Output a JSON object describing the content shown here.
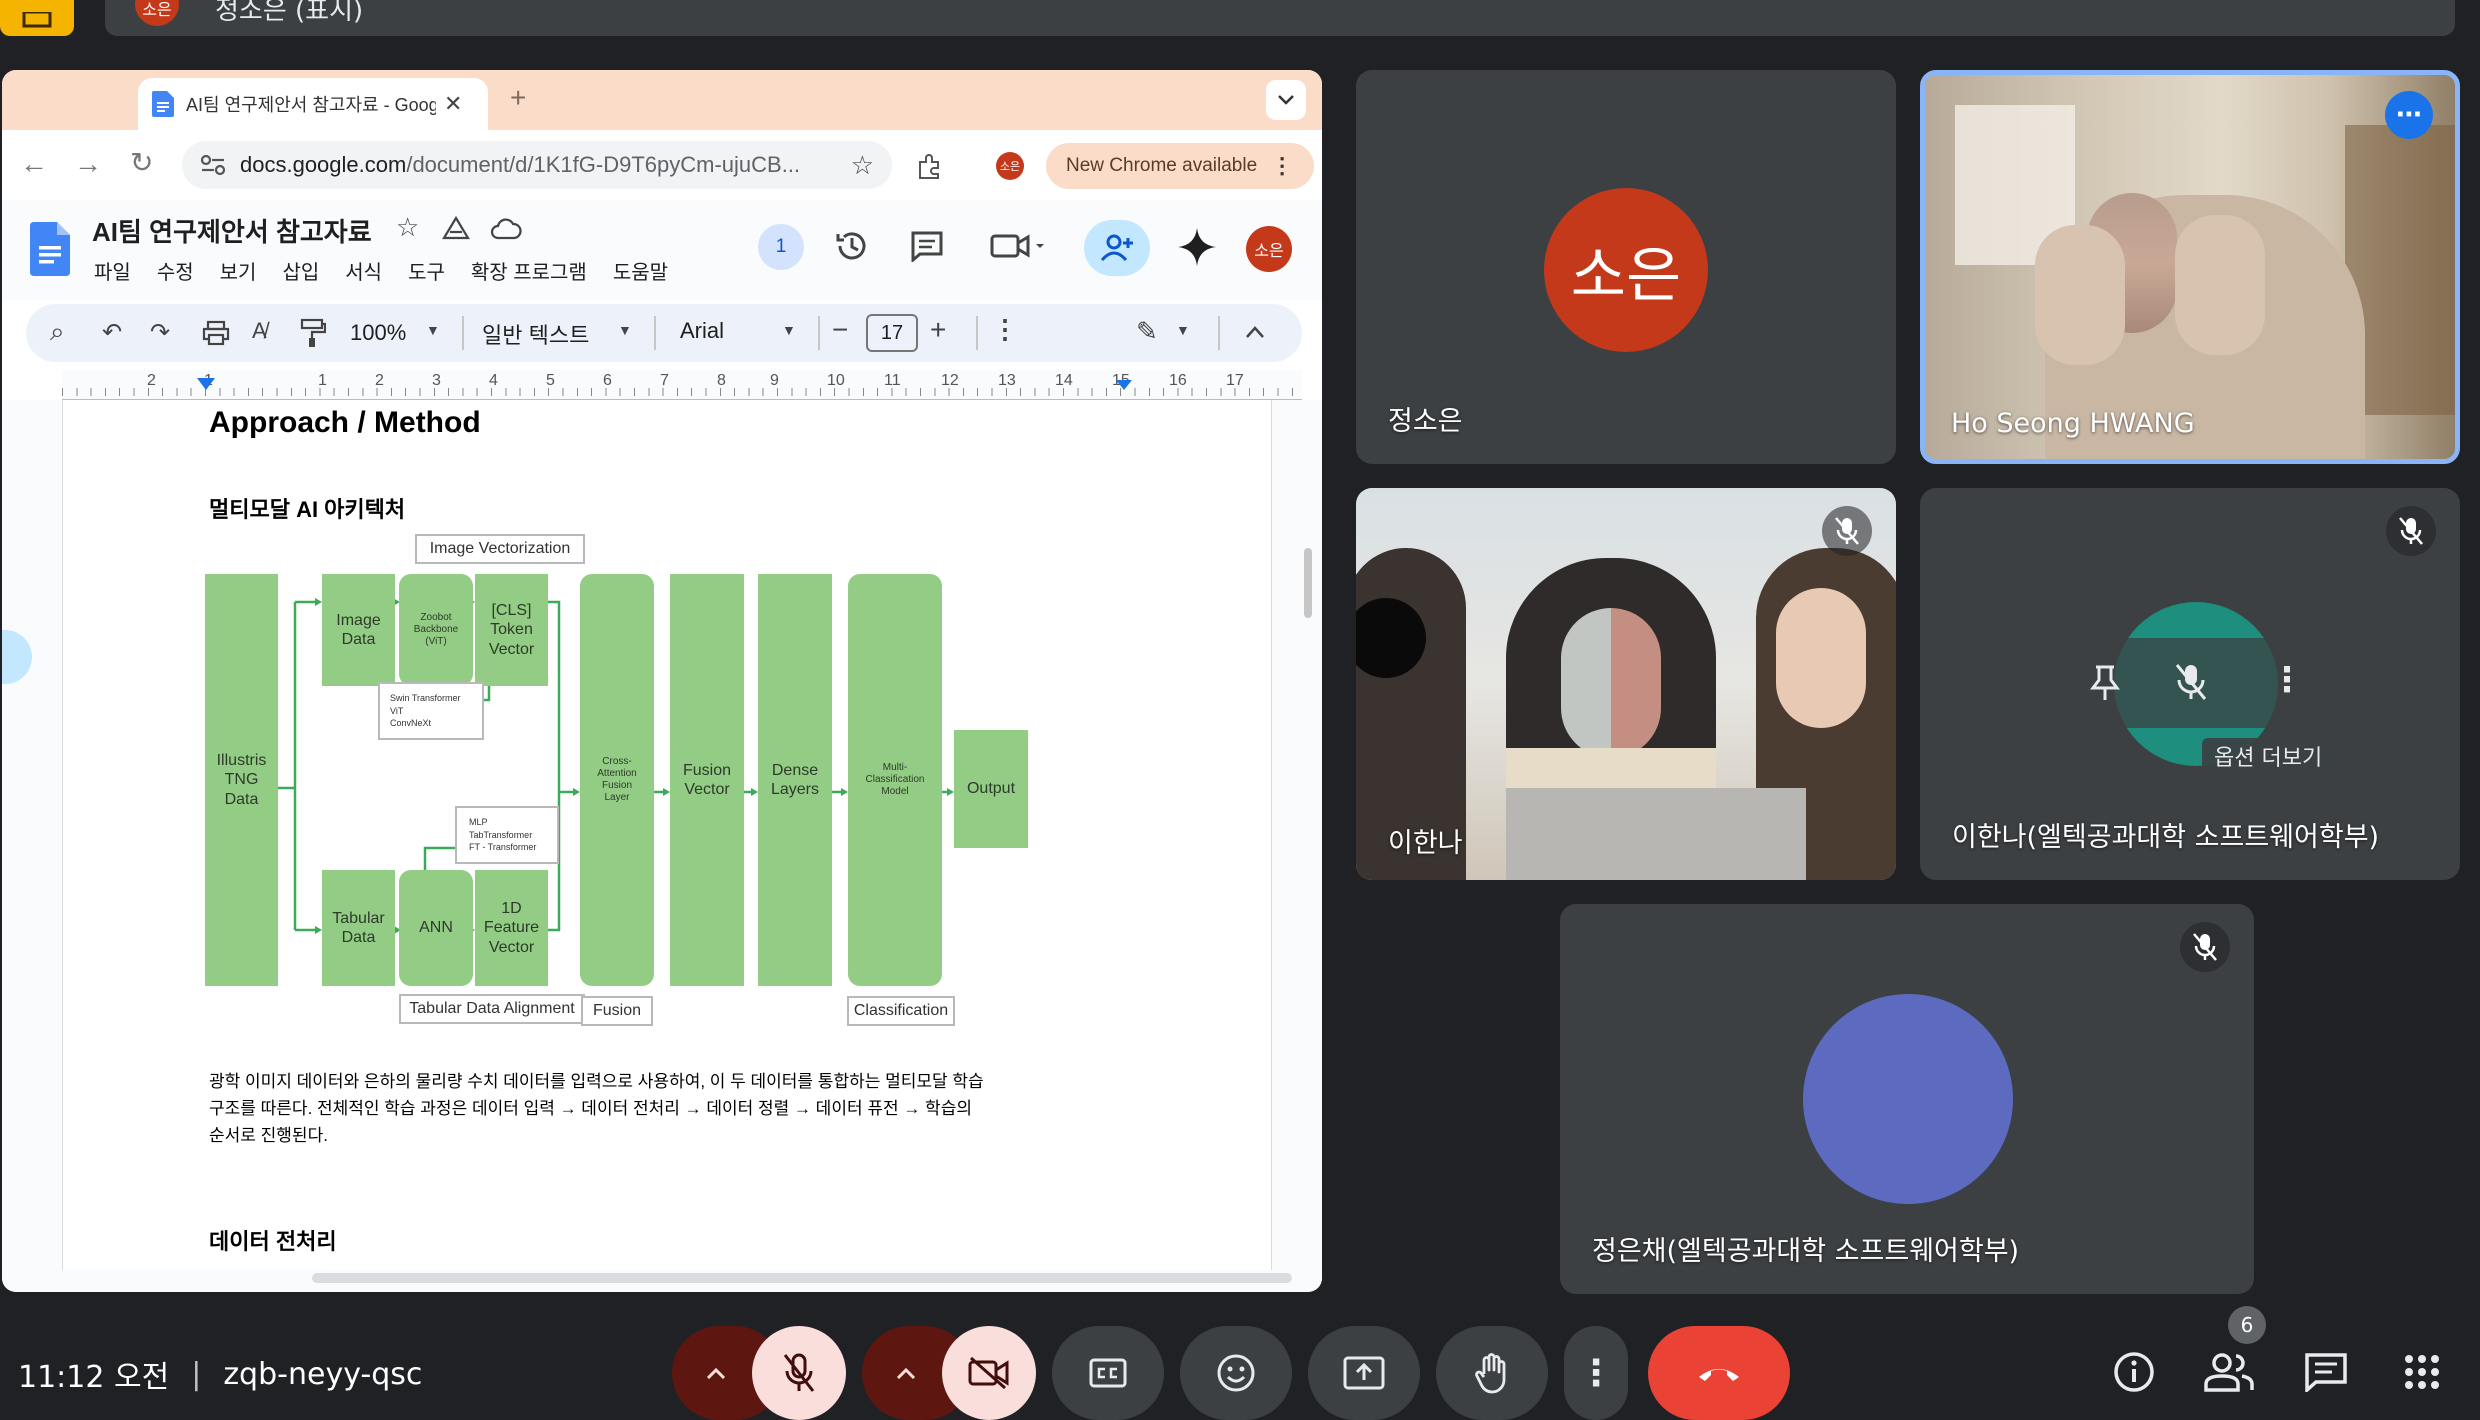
{
  "meet_top": {
    "avatar": "소은",
    "presenter": "정소은 (표시)"
  },
  "browser": {
    "tab_title": "AI팀 연구제안서 참고자료 - Goog",
    "new_tab": "+",
    "url_domain": "docs.google.com",
    "url_path": "/document/d/1K1fG-D9T6pyCm-ujuCB...",
    "profile": "소은",
    "update_btn": "New Chrome available"
  },
  "docs": {
    "title": "AI팀 연구제안서 참고자료",
    "menus": [
      "파일",
      "수정",
      "보기",
      "삽입",
      "서식",
      "도구",
      "확장 프로그램",
      "도움말"
    ],
    "badge_count": "1",
    "avatar": "소은",
    "zoom": "100%",
    "style": "일반 텍스트",
    "font": "Arial",
    "font_size": "17",
    "minus": "−",
    "plus": "+",
    "ruler": [
      "2",
      "1",
      "1",
      "2",
      "3",
      "4",
      "5",
      "6",
      "7",
      "8",
      "9",
      "10",
      "11",
      "12",
      "13",
      "14",
      "15",
      "16",
      "17",
      "18"
    ],
    "heading": "Approach / Method",
    "subheading": "멀티모달 AI 아키텍처",
    "para_lines": [
      "광학 이미지 데이터와 은하의 물리량 수치 데이터를 입력으로 사용하여, 이 두 데이터를 통합하는 멀티모달 학습",
      "구조를 따른다. 전체적인 학습 과정은 데이터 입력 → 데이터 전처리 → 데이터 정렬 → 데이터 퓨전 → 학습의",
      "순서로 진행된다."
    ],
    "next_heading": "데이터 전처리"
  },
  "diagram": {
    "labels": {
      "image_vec": "Image Vectorization",
      "tabular_align": "Tabular Data Alignment",
      "fusion": "Fusion",
      "classification": "Classification"
    },
    "boxes": {
      "illustris": [
        "Illustris",
        "TNG",
        "Data"
      ],
      "image_data": [
        "Image",
        "Data"
      ],
      "zoobot": [
        "Zoobot",
        "Backbone",
        "(ViT)"
      ],
      "cls": [
        "[CLS]",
        "Token",
        "Vector"
      ],
      "swin": [
        "Swin Transformer",
        "ViT",
        "ConvNeXt"
      ],
      "mlp": [
        "MLP",
        "TabTransformer",
        "FT - Transformer"
      ],
      "tabular": [
        "Tabular",
        "Data"
      ],
      "ann": [
        "ANN"
      ],
      "feature": [
        "1D",
        "Feature",
        "Vector"
      ],
      "cross": [
        "Cross-",
        "Attention",
        "Fusion",
        "Layer"
      ],
      "fusion_vec": [
        "Fusion",
        "Vector"
      ],
      "dense": [
        "Dense",
        "Layers"
      ],
      "multi": [
        "Multi-",
        "Classification",
        "Model"
      ],
      "output": [
        "Output"
      ]
    }
  },
  "participants": {
    "p1": {
      "avatar": "소은",
      "name": "정소은",
      "color": "#c5391b"
    },
    "p2": {
      "name": "Ho Seong HWANG"
    },
    "p3": {
      "name": "이한나"
    },
    "p4": {
      "name": "이한나(엘텍공과대학 소프트웨어학부)",
      "tooltip": "옵션 더보기",
      "avatar_color": "#1e8e7e"
    },
    "p5": {
      "name": "정은채(엘텍공과대학 소프트웨어학부)",
      "avatar_color": "#5c6bc0"
    }
  },
  "bottom": {
    "time": "11:12 오전",
    "separator": "|",
    "meeting_code": "zqb-neyy-qsc",
    "people_count": "6"
  },
  "colors": {
    "meet_bg": "#202124",
    "tile_bg": "#3c4043",
    "end_call": "#ea4335",
    "docs_blue": "#1a73e8",
    "diagram_green": "#93cc85"
  }
}
